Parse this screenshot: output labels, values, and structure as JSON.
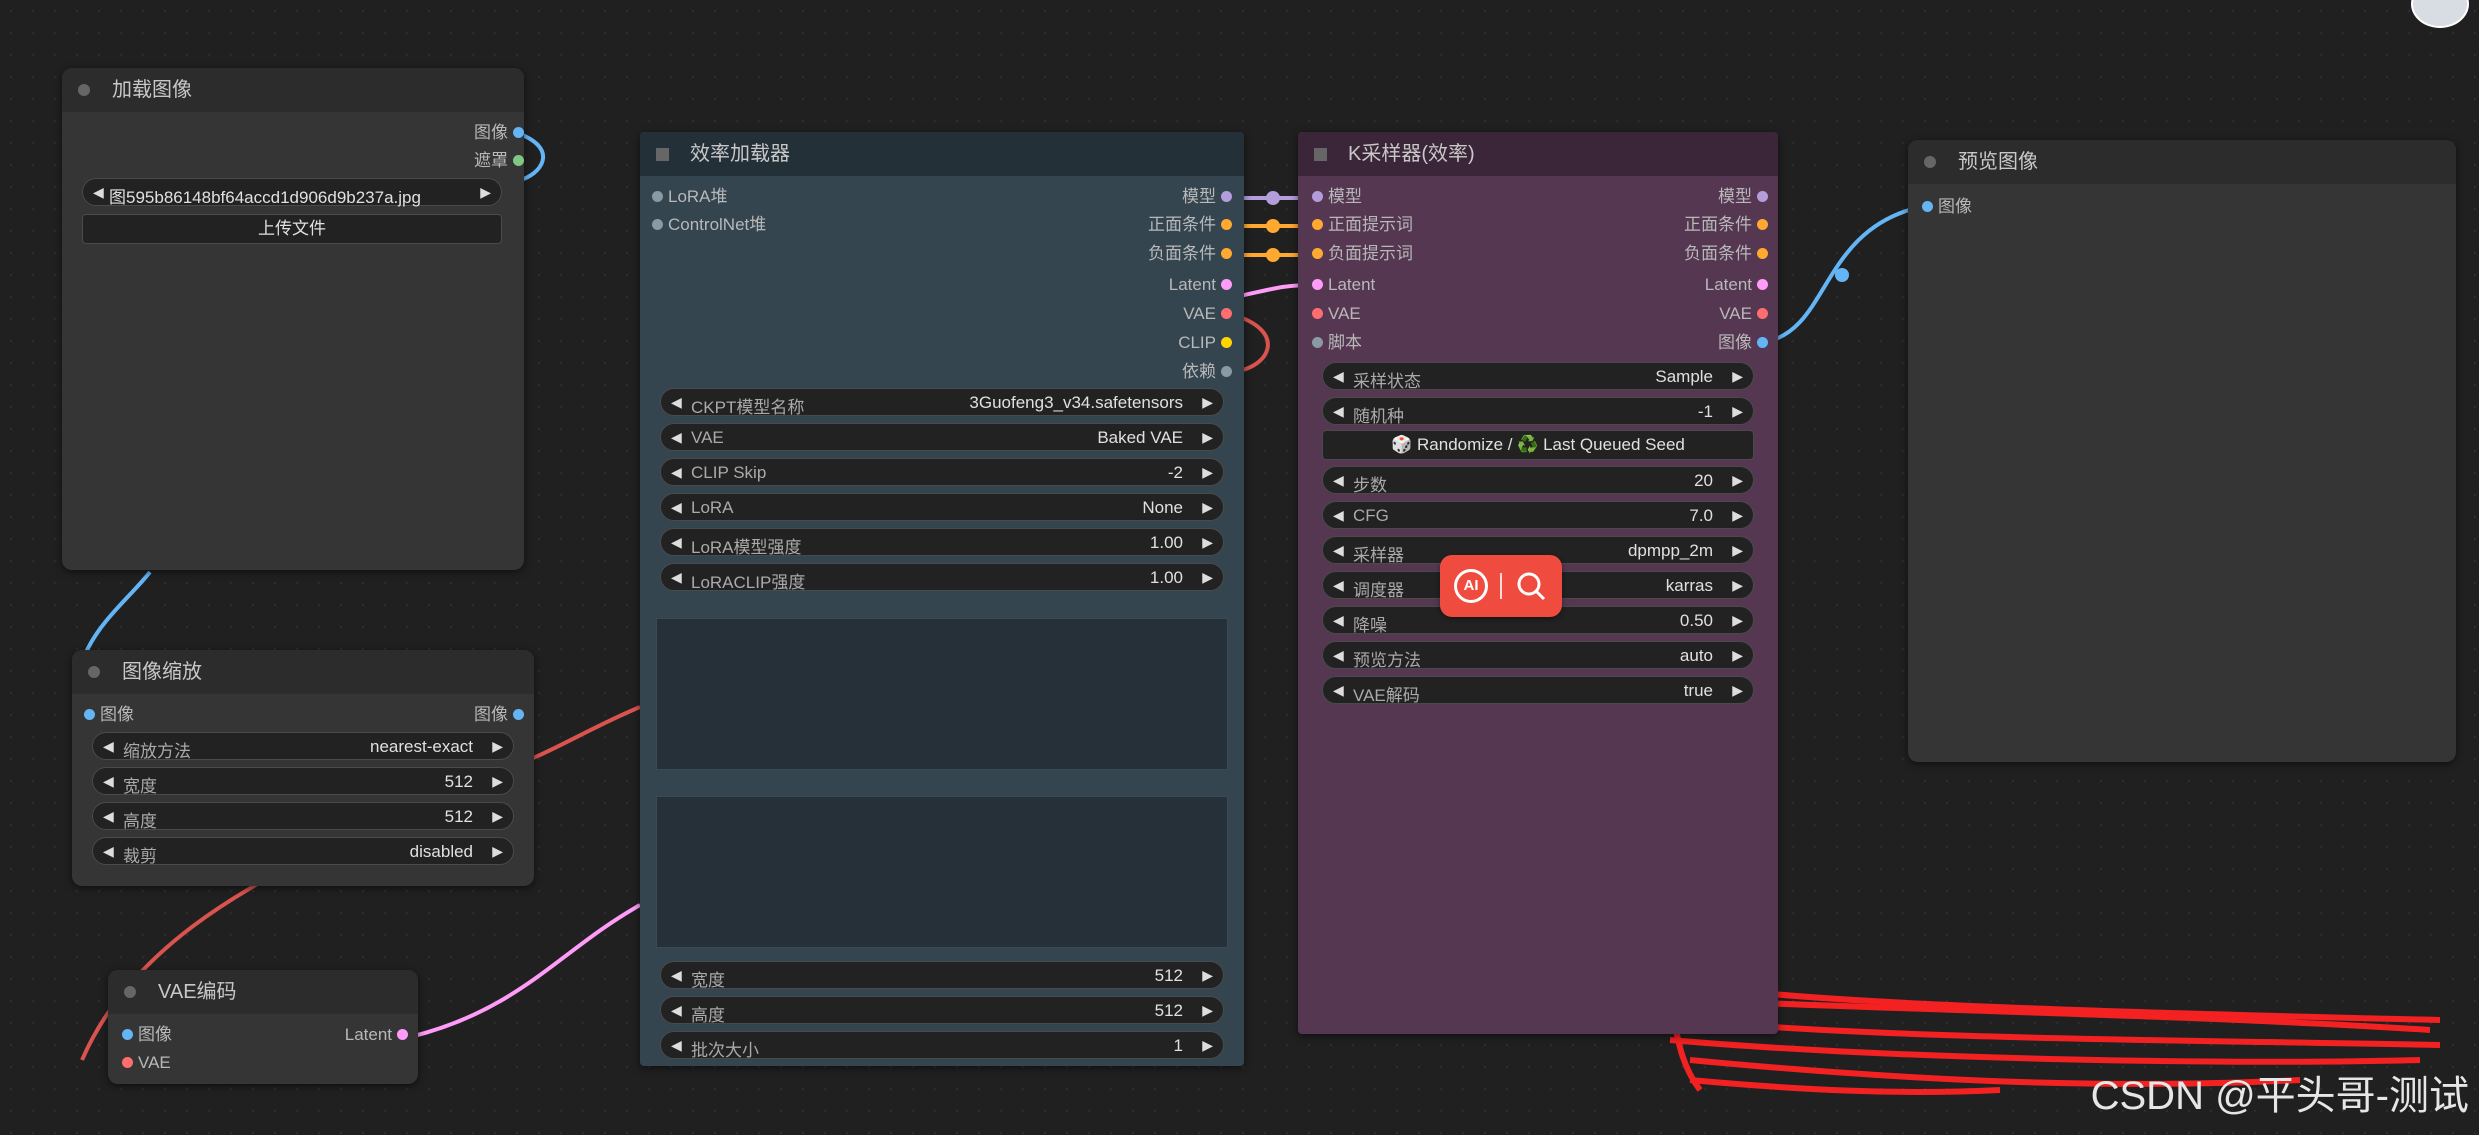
{
  "colors": {
    "canvas": "#202020",
    "model": "#b39ddb",
    "conditioning": "#ffa931",
    "latent": "#ff9cf9",
    "vae": "#ff6e6e",
    "clip": "#ffd500",
    "image": "#64b5f6",
    "mask": "#81c784",
    "depends": "#8a9aa4"
  },
  "load_image": {
    "title": "加载图像",
    "outputs": [
      {
        "label": "图像",
        "color": "image"
      },
      {
        "label": "遮罩",
        "color": "mask"
      }
    ],
    "file_value": "图595b86148bf64accd1d906d9b237a.jpg",
    "upload_label": "上传文件"
  },
  "image_scale": {
    "title": "图像缩放",
    "input": "图像",
    "output": "图像",
    "widgets": [
      {
        "label": "缩放方法",
        "value": "nearest-exact"
      },
      {
        "label": "宽度",
        "value": "512"
      },
      {
        "label": "高度",
        "value": "512"
      },
      {
        "label": "裁剪",
        "value": "disabled"
      }
    ]
  },
  "vae_encode": {
    "title": "VAE编码",
    "inputs": [
      "图像",
      "VAE"
    ],
    "output": "Latent"
  },
  "eff_loader": {
    "title": "效率加载器",
    "inputs": [
      "LoRA堆",
      "ControlNet堆"
    ],
    "outputs": [
      "模型",
      "正面条件",
      "负面条件",
      "Latent",
      "VAE",
      "CLIP",
      "依赖"
    ],
    "widgets": [
      {
        "label": "CKPT模型名称",
        "value": "3Guofeng3_v34.safetensors"
      },
      {
        "label": "VAE",
        "value": "Baked VAE"
      },
      {
        "label": "CLIP Skip",
        "value": "-2"
      },
      {
        "label": "LoRA",
        "value": "None"
      },
      {
        "label": "LoRA模型强度",
        "value": "1.00"
      },
      {
        "label": "LoRACLIP强度",
        "value": "1.00"
      }
    ],
    "widgets_bottom": [
      {
        "label": "宽度",
        "value": "512"
      },
      {
        "label": "高度",
        "value": "512"
      },
      {
        "label": "批次大小",
        "value": "1"
      }
    ]
  },
  "ksampler": {
    "title": "K采样器(效率)",
    "inputs": [
      "模型",
      "正面提示词",
      "负面提示词",
      "Latent",
      "VAE",
      "脚本"
    ],
    "outputs": [
      "模型",
      "正面条件",
      "负面条件",
      "Latent",
      "VAE",
      "图像"
    ],
    "widgets": [
      {
        "label": "采样状态",
        "value": "Sample"
      },
      {
        "label": "随机种",
        "value": "-1"
      }
    ],
    "seed_button": "🎲 Randomize / ♻️ Last Queued Seed",
    "widgets2": [
      {
        "label": "步数",
        "value": "20"
      },
      {
        "label": "CFG",
        "value": "7.0"
      },
      {
        "label": "采样器",
        "value": "dpmpp_2m"
      },
      {
        "label": "调度器",
        "value": "karras"
      },
      {
        "label": "降噪",
        "value": "0.50"
      },
      {
        "label": "预览方法",
        "value": "auto"
      },
      {
        "label": "VAE解码",
        "value": "true"
      }
    ]
  },
  "preview": {
    "title": "预览图像",
    "input": "图像"
  },
  "ai_button": {
    "icon_left": "AI",
    "icon_right": "search-icon"
  },
  "watermark": "CSDN @平头哥-测试"
}
